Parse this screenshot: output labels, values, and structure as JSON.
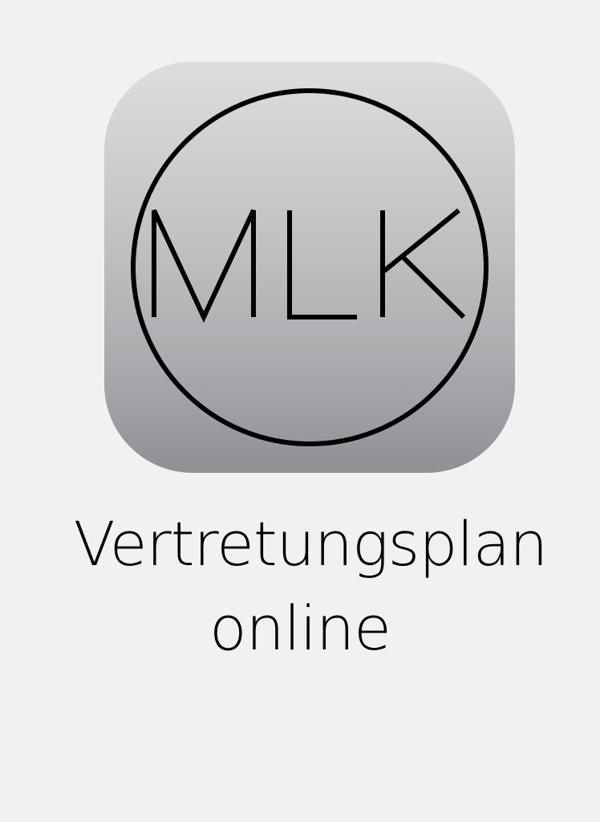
{
  "app_icon": {
    "logo_text": "MLK",
    "background_gradient": [
      "#dcdddf",
      "#8f9094"
    ],
    "ring_color": "#000000"
  },
  "caption": {
    "line1": "Vertretungsplan",
    "line2": "online"
  },
  "page": {
    "background": "#f1f1f1"
  }
}
